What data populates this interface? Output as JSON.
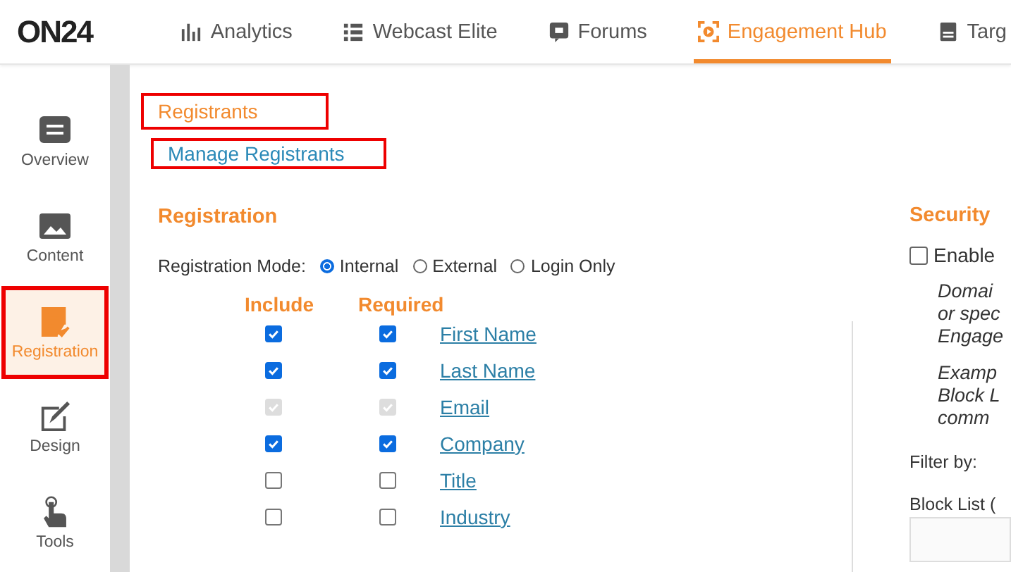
{
  "nav": {
    "logo": "ON24",
    "tabs": [
      {
        "label": "Analytics",
        "kind": "bars",
        "selected": false
      },
      {
        "label": "Webcast Elite",
        "kind": "list",
        "selected": false
      },
      {
        "label": "Forums",
        "kind": "chat",
        "selected": false
      },
      {
        "label": "Engagement Hub",
        "kind": "hub",
        "selected": true
      },
      {
        "label": "Targ",
        "kind": "doc",
        "selected": false
      }
    ]
  },
  "sidebar": {
    "items": [
      {
        "label": "Overview",
        "kind": "overview",
        "selected": false,
        "highlighted": false
      },
      {
        "label": "Content",
        "kind": "image",
        "selected": false,
        "highlighted": false
      },
      {
        "label": "Registration",
        "kind": "form",
        "selected": true,
        "highlighted": true
      },
      {
        "label": "Design",
        "kind": "design",
        "selected": false,
        "highlighted": false
      },
      {
        "label": "Tools",
        "kind": "hand",
        "selected": false,
        "highlighted": false
      }
    ]
  },
  "page": {
    "title": {
      "text": "Registrants",
      "highlighted": true
    },
    "link": {
      "text": "Manage Registrants",
      "highlighted": true
    }
  },
  "registration": {
    "heading": "Registration",
    "mode_label": "Registration Mode:",
    "modes": [
      {
        "label": "Internal",
        "selected": true
      },
      {
        "label": "External",
        "selected": false
      },
      {
        "label": "Login Only",
        "selected": false
      }
    ],
    "columns": [
      "Include",
      "Required"
    ],
    "fields": [
      {
        "label": "First Name",
        "include": true,
        "required": true,
        "disabled": false
      },
      {
        "label": "Last Name",
        "include": true,
        "required": true,
        "disabled": false
      },
      {
        "label": "Email",
        "include": true,
        "required": true,
        "disabled": true
      },
      {
        "label": "Company",
        "include": true,
        "required": true,
        "disabled": false
      },
      {
        "label": "Title",
        "include": false,
        "required": false,
        "disabled": false
      },
      {
        "label": "Industry",
        "include": false,
        "required": false,
        "disabled": false
      }
    ]
  },
  "security": {
    "heading": "Security",
    "enable": {
      "label": "Enable",
      "checked": false
    },
    "notes": [
      [
        "Domai",
        "or spec",
        "Engage"
      ],
      [
        "Examp",
        "Block L",
        "comm"
      ]
    ],
    "filter_label": "Filter by:",
    "block_list_label": "Block List ("
  }
}
